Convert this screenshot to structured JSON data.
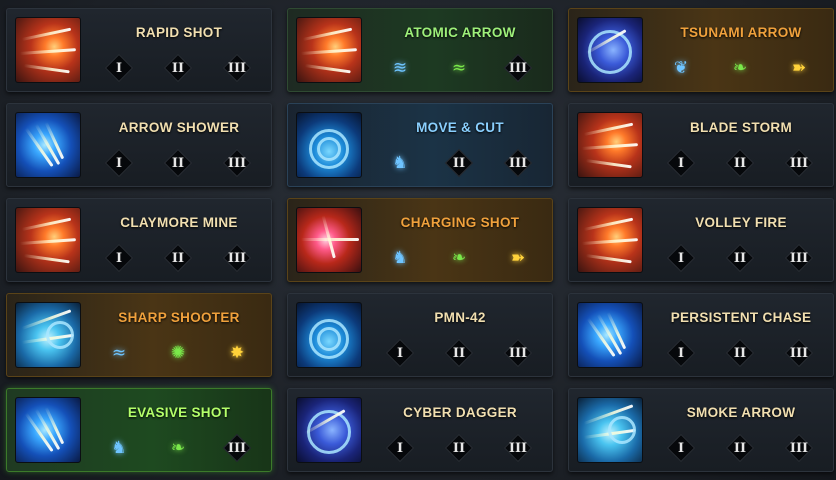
{
  "skills": [
    {
      "name": "RAPID SHOT",
      "name_color": "default",
      "tint": "",
      "icon": "rapid-shot-icon",
      "icon_style": "ic-red",
      "slots": [
        {
          "kind": "numeral",
          "label": "I"
        },
        {
          "kind": "numeral",
          "label": "II"
        },
        {
          "kind": "numeral",
          "label": "III"
        }
      ]
    },
    {
      "name": "ATOMIC ARROW",
      "name_color": "c-green",
      "tint": "t-green",
      "icon": "atomic-arrow-icon",
      "icon_style": "ic-red",
      "slots": [
        {
          "kind": "rune",
          "color": "blue",
          "glyph": "≋",
          "icon": "wind-rune-icon"
        },
        {
          "kind": "rune",
          "color": "green",
          "glyph": "≈",
          "icon": "claw-rune-icon"
        },
        {
          "kind": "numeral",
          "label": "III"
        }
      ]
    },
    {
      "name": "TSUNAMI ARROW",
      "name_color": "c-orange",
      "tint": "t-orange",
      "icon": "tsunami-arrow-icon",
      "icon_style": "ic-violet",
      "slots": [
        {
          "kind": "rune",
          "color": "blue",
          "glyph": "❦",
          "icon": "feather-rune-icon"
        },
        {
          "kind": "rune",
          "color": "green",
          "glyph": "❧",
          "icon": "leaf-rune-icon"
        },
        {
          "kind": "rune",
          "color": "yellow",
          "glyph": "➽",
          "icon": "comet-rune-icon"
        }
      ]
    },
    {
      "name": "ARROW SHOWER",
      "name_color": "default",
      "tint": "",
      "icon": "arrow-shower-icon",
      "icon_style": "ic-blue",
      "slots": [
        {
          "kind": "numeral",
          "label": "I"
        },
        {
          "kind": "numeral",
          "label": "II"
        },
        {
          "kind": "numeral",
          "label": "III"
        }
      ]
    },
    {
      "name": "MOVE & CUT",
      "name_color": "c-blue",
      "tint": "t-blue",
      "icon": "move-and-cut-icon",
      "icon_style": "ic-blue2",
      "slots": [
        {
          "kind": "rune",
          "color": "blue",
          "glyph": "♞",
          "icon": "footstep-rune-icon"
        },
        {
          "kind": "numeral",
          "label": "II"
        },
        {
          "kind": "numeral",
          "label": "III"
        }
      ]
    },
    {
      "name": "BLADE STORM",
      "name_color": "default",
      "tint": "",
      "icon": "blade-storm-icon",
      "icon_style": "ic-red",
      "slots": [
        {
          "kind": "numeral",
          "label": "I"
        },
        {
          "kind": "numeral",
          "label": "II"
        },
        {
          "kind": "numeral",
          "label": "III"
        }
      ]
    },
    {
      "name": "CLAYMORE MINE",
      "name_color": "default",
      "tint": "",
      "icon": "claymore-mine-icon",
      "icon_style": "ic-red",
      "slots": [
        {
          "kind": "numeral",
          "label": "I"
        },
        {
          "kind": "numeral",
          "label": "II"
        },
        {
          "kind": "numeral",
          "label": "III"
        }
      ]
    },
    {
      "name": "CHARGING SHOT",
      "name_color": "c-orange",
      "tint": "t-orange",
      "icon": "charging-shot-icon",
      "icon_style": "ic-pink",
      "slots": [
        {
          "kind": "rune",
          "color": "blue",
          "glyph": "♞",
          "icon": "footstep-rune-icon"
        },
        {
          "kind": "rune",
          "color": "green",
          "glyph": "❧",
          "icon": "leaf-rune-icon"
        },
        {
          "kind": "rune",
          "color": "yellow",
          "glyph": "➽",
          "icon": "comet-rune-icon"
        }
      ]
    },
    {
      "name": "VOLLEY FIRE",
      "name_color": "default",
      "tint": "",
      "icon": "volley-fire-icon",
      "icon_style": "ic-red",
      "slots": [
        {
          "kind": "numeral",
          "label": "I"
        },
        {
          "kind": "numeral",
          "label": "II"
        },
        {
          "kind": "numeral",
          "label": "III"
        }
      ]
    },
    {
      "name": "SHARP SHOOTER",
      "name_color": "c-orange",
      "tint": "t-orange",
      "icon": "sharp-shooter-icon",
      "icon_style": "ic-cyan",
      "slots": [
        {
          "kind": "rune",
          "color": "blue",
          "glyph": "≈",
          "icon": "claw-rune-icon"
        },
        {
          "kind": "rune",
          "color": "green",
          "glyph": "✺",
          "icon": "orb-rune-icon"
        },
        {
          "kind": "rune",
          "color": "yellow",
          "glyph": "✸",
          "icon": "spark-rune-icon"
        }
      ]
    },
    {
      "name": "PMN-42",
      "name_color": "default",
      "tint": "",
      "icon": "pmn-42-icon",
      "icon_style": "ic-blue2",
      "slots": [
        {
          "kind": "numeral",
          "label": "I"
        },
        {
          "kind": "numeral",
          "label": "II"
        },
        {
          "kind": "numeral",
          "label": "III"
        }
      ]
    },
    {
      "name": "PERSISTENT CHASE",
      "name_color": "default",
      "tint": "",
      "icon": "persistent-chase-icon",
      "icon_style": "ic-blue",
      "slots": [
        {
          "kind": "numeral",
          "label": "I"
        },
        {
          "kind": "numeral",
          "label": "II"
        },
        {
          "kind": "numeral",
          "label": "III"
        }
      ]
    },
    {
      "name": "EVASIVE SHOT",
      "name_color": "c-bright-green",
      "tint": "t-bright-green",
      "icon": "evasive-shot-icon",
      "icon_style": "ic-blue",
      "slots": [
        {
          "kind": "rune",
          "color": "blue",
          "glyph": "♞",
          "icon": "footstep-rune-icon"
        },
        {
          "kind": "rune",
          "color": "green",
          "glyph": "❧",
          "icon": "leaf-rune-icon"
        },
        {
          "kind": "numeral",
          "label": "III"
        }
      ]
    },
    {
      "name": "CYBER DAGGER",
      "name_color": "default",
      "tint": "",
      "icon": "cyber-dagger-icon",
      "icon_style": "ic-violet",
      "slots": [
        {
          "kind": "numeral",
          "label": "I"
        },
        {
          "kind": "numeral",
          "label": "II"
        },
        {
          "kind": "numeral",
          "label": "III"
        }
      ]
    },
    {
      "name": "SMOKE ARROW",
      "name_color": "default",
      "tint": "",
      "icon": "smoke-arrow-icon",
      "icon_style": "ic-cyan",
      "slots": [
        {
          "kind": "numeral",
          "label": "I"
        },
        {
          "kind": "numeral",
          "label": "II"
        },
        {
          "kind": "numeral",
          "label": "III"
        }
      ]
    }
  ],
  "colors": {
    "default_name": "#f1dfb0",
    "green_name": "#9ef07a",
    "orange_name": "#f0a13c",
    "blue_name": "#8ad0ff",
    "bright_green_name": "#b4ff6a",
    "rune_blue": "#6ec4ff",
    "rune_green": "#7ae84a",
    "rune_yellow": "#ffd23a"
  }
}
